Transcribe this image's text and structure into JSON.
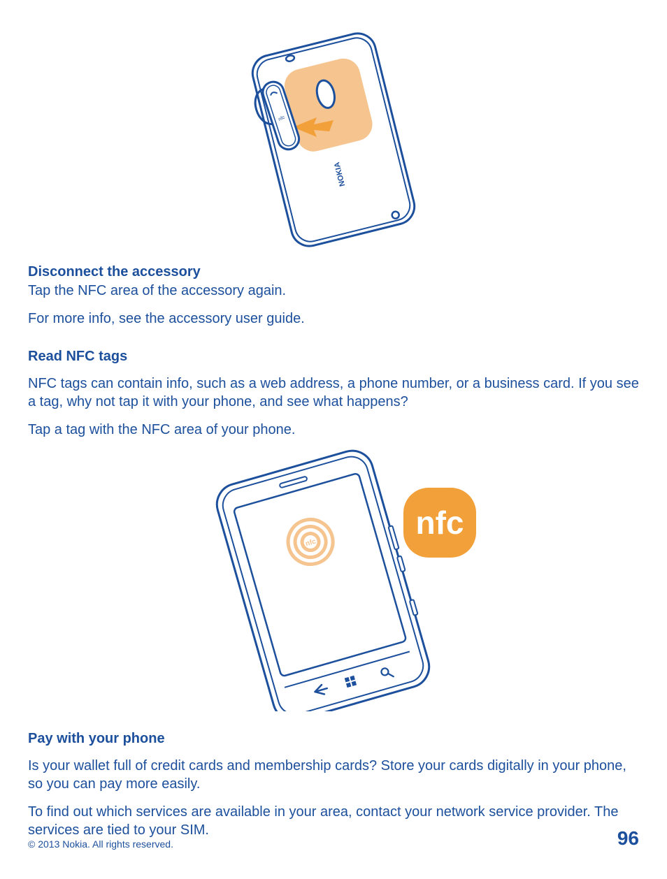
{
  "figure1": {
    "brand_label": "NOKIA",
    "accessory_label": "nfc"
  },
  "section_disconnect": {
    "heading": "Disconnect the accessory",
    "line1": "Tap the NFC area of the accessory again.",
    "line2": "For more info, see the accessory user guide."
  },
  "section_read": {
    "heading": "Read NFC tags",
    "para1": "NFC tags can contain info, such as a web address, a phone number, or a business card. If you see a tag, why not tap it with your phone, and see what happens?",
    "para2": "Tap a tag with the NFC area of your phone."
  },
  "figure2": {
    "badge_label": "nfc",
    "screen_nfc_label": "nfc"
  },
  "section_pay": {
    "heading": "Pay with your phone",
    "para1": "Is your wallet full of credit cards and membership cards? Store your cards digitally in your phone, so you can pay more easily.",
    "para2": "To find out which services are available in your area, contact your network service provider. The services are tied to your SIM."
  },
  "footer": {
    "copyright": "© 2013 Nokia. All rights reserved.",
    "page_number": "96"
  },
  "colors": {
    "brand_blue": "#1c4f9c",
    "nfc_orange": "#f2a03a",
    "nfc_orange_light": "#f5c48f"
  }
}
